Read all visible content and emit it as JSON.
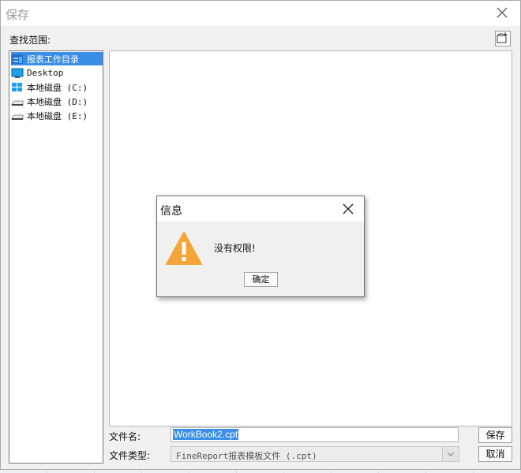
{
  "dialog": {
    "title": "保存",
    "look_in_label": "查找范围:"
  },
  "tree": {
    "items": [
      {
        "label": "报表工作目录",
        "icon": "report-folder-icon"
      },
      {
        "label": "Desktop",
        "icon": "desktop-icon"
      },
      {
        "label": "本地磁盘 (C:)",
        "icon": "windows-drive-icon"
      },
      {
        "label": "本地磁盘 (D:)",
        "icon": "drive-icon"
      },
      {
        "label": "本地磁盘 (E:)",
        "icon": "drive-icon"
      }
    ]
  },
  "form": {
    "filename_label": "文件名:",
    "filename_value": "WorkBook2.cpt",
    "filetype_label": "文件类型:",
    "filetype_value": "FineReport报表模板文件 (.cpt)",
    "save_label": "保存",
    "cancel_label": "取消"
  },
  "modal": {
    "title": "信息",
    "message": "没有权限!",
    "ok_label": "确定"
  },
  "colors": {
    "accent": "#3a8ee6",
    "warning": "#f4a53a"
  }
}
